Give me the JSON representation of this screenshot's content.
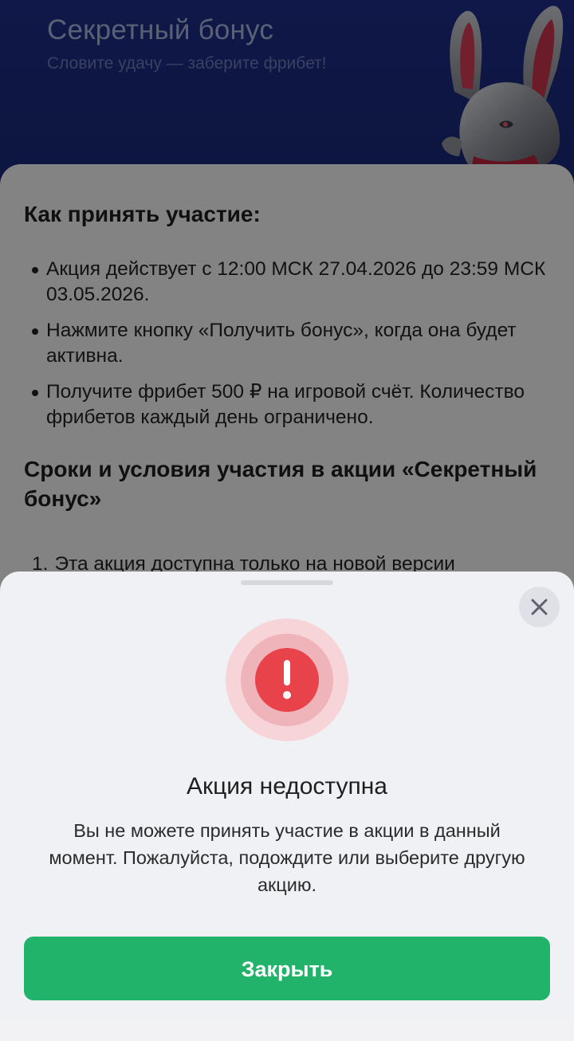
{
  "header": {
    "title": "Секретный бонус",
    "subtitle": "Словите удачу — заберите фрибет!"
  },
  "rules": {
    "how_title": "Как принять участие:",
    "bullets": [
      "Акция действует с 12:00 МСК 27.04.2026 до 23:59 МСК 03.05.2026.",
      "Нажмите кнопку «Получить бонус», когда она будет активна.",
      "Получите фрибет 500 ₽ на игровой счёт. Количество фрибетов каждый день ограничено."
    ],
    "terms_title": "Сроки и условия участия в акции «Секретный бонус»",
    "terms": [
      {
        "num": "1.",
        "text": "Эта акция доступна только на новой версии"
      }
    ]
  },
  "sheet": {
    "title": "Акция недоступна",
    "message": "Вы не можете принять участие в акции в данный момент. Пожалуйста, подождите или выберите другую акцию.",
    "close_button": "Закрыть"
  },
  "colors": {
    "header_bg": "#1b2a7a",
    "accent_green": "#21b36a",
    "alert_red": "#e8424a"
  },
  "icons": {
    "mascot": "silver-rabbit-icon",
    "close": "close-icon",
    "alert": "exclamation-alert-icon"
  }
}
